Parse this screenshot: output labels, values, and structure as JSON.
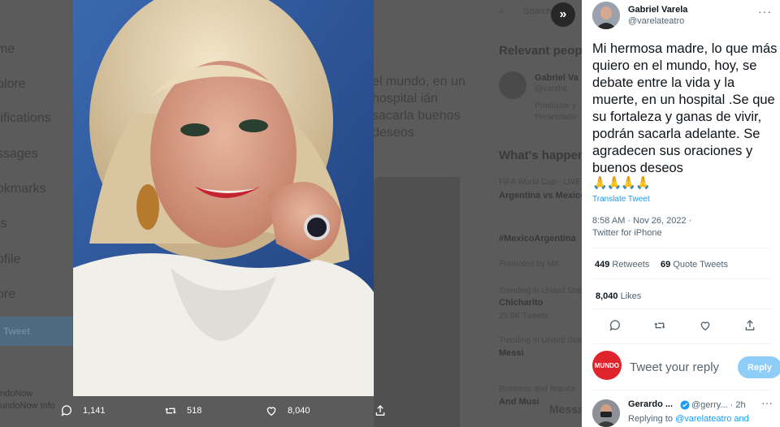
{
  "background": {
    "nav_items": [
      "me",
      "plore",
      "tifications",
      "ssages",
      "okmarks",
      "ts",
      "ofile",
      "ore"
    ],
    "tweet_button": "Tweet",
    "account_lines": [
      "ndoNow",
      "undoNow Info"
    ],
    "center_text": "el mundo, en un hospital ián sacarla buenos deseos",
    "right": {
      "search_placeholder": "Search",
      "relevant_people": "Relevant people",
      "relevant_name": "Gabriel Va",
      "relevant_handle": "@varelat",
      "relevant_bio": "Productor y Presentado",
      "whats_happening": "What's happening",
      "trend1_meta": "FIFA World Cup · LIVE",
      "trend1": "Argentina vs Mexico",
      "trend2": "#MexicoArgentina",
      "trend2_meta": "Promoted by MX",
      "trend3_meta": "Trending in United States",
      "trend3": "Chicharito",
      "trend3_count": "25.8K Tweets",
      "trend4_meta": "Trending in United States",
      "trend4": "Messi",
      "trend5_meta": "Business and finance",
      "trend5": "And Musi",
      "messages": "Messa"
    }
  },
  "media_actions": {
    "replies": "1,141",
    "retweets": "518",
    "likes": "8,040"
  },
  "tweet": {
    "author_name": "Gabriel Varela",
    "author_handle": "@varelateatro",
    "text": "Mi hermosa madre, lo que más quiero en el mundo, hoy, se debate entre la vida y la muerte, en un hospital .Se que su fortaleza y ganas de vivir, podrán sacarla adelante. Se agradecen sus oraciones y buenos deseos",
    "emoji": "🙏🙏🙏🙏",
    "translate": "Translate Tweet",
    "time": "8:58 AM · Nov 26, 2022 ·",
    "source": "Twitter for iPhone",
    "retweets_count": "449",
    "retweets_label": "Retweets",
    "quotes_count": "69",
    "quotes_label": "Quote Tweets",
    "likes_count": "8,040",
    "likes_label": "Likes"
  },
  "reply_composer": {
    "avatar_text": "MUNDO",
    "placeholder": "Tweet your reply",
    "button": "Reply"
  },
  "reply": {
    "name": "Gerardo ...",
    "handle_time": "@gerry... · 2h",
    "replying_prefix": "Replying to",
    "replying_to": "@varelateatro and"
  },
  "colors": {
    "accent": "#1d9bf0",
    "reply_button": "#8ecdf8",
    "mundo_red": "#e0242c"
  }
}
